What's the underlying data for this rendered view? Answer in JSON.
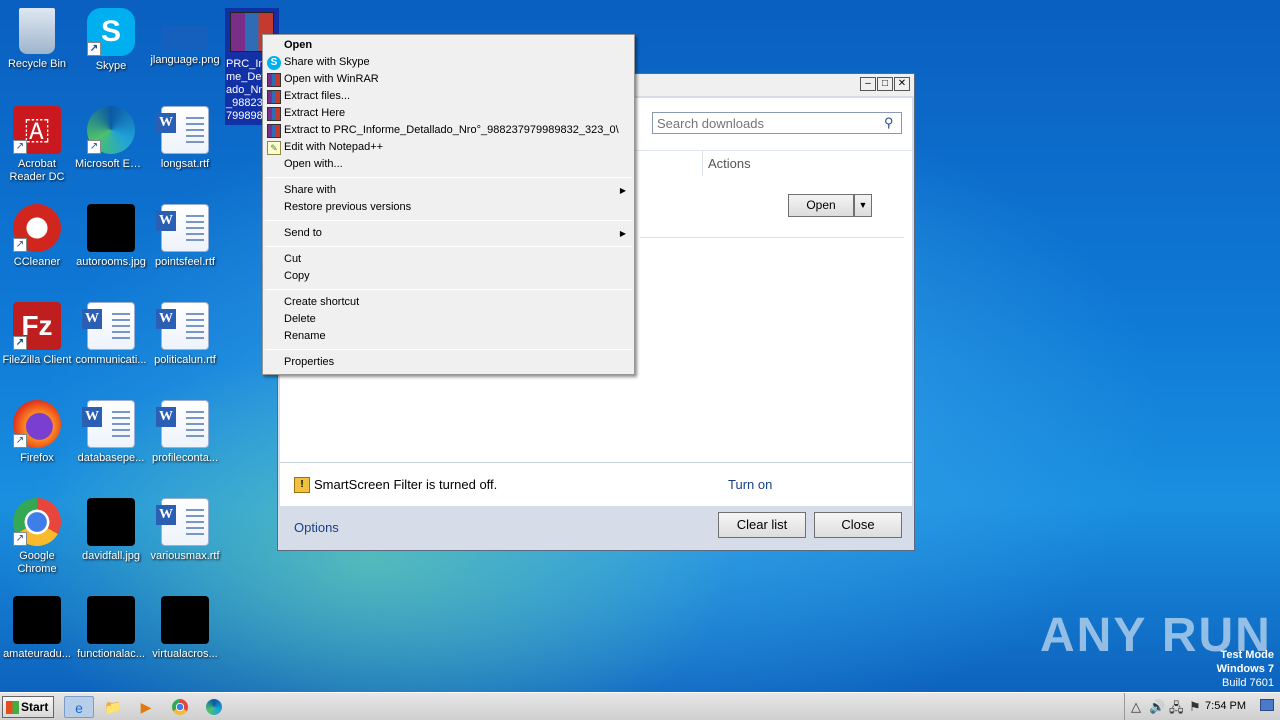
{
  "desktop": {
    "icons": [
      {
        "label": "Recycle Bin"
      },
      {
        "label": "Skype"
      },
      {
        "label": "jlanguage.png"
      },
      {
        "label": "Acrobat Reader DC"
      },
      {
        "label": "Microsoft Edge"
      },
      {
        "label": "longsat.rtf"
      },
      {
        "label": "CCleaner"
      },
      {
        "label": "autorooms.jpg"
      },
      {
        "label": "pointsfeel.rtf"
      },
      {
        "label": "FileZilla Client"
      },
      {
        "label": "communicati..."
      },
      {
        "label": "politicalun.rtf"
      },
      {
        "label": "Firefox"
      },
      {
        "label": "databasepe..."
      },
      {
        "label": "profileconta..."
      },
      {
        "label": "Google Chrome"
      },
      {
        "label": "davidfall.jpg"
      },
      {
        "label": "variousmax.rtf"
      },
      {
        "label": "amateuradu..."
      },
      {
        "label": "functionalac..."
      },
      {
        "label": "virtualacros..."
      }
    ],
    "selected_file_label": "PRC_Informe_Detallado_Nro°_988237979989832_uu"
  },
  "downloads_window": {
    "search_placeholder": "Search downloads",
    "actions_header": "Actions",
    "open_button": "Open",
    "smartscreen_text": "SmartScreen Filter is turned off.",
    "turn_on_link": "Turn on",
    "options_link": "Options",
    "clear_list_button": "Clear list",
    "close_button": "Close"
  },
  "context_menu": {
    "open": "Open",
    "share_skype": "Share with Skype",
    "open_winrar": "Open with WinRAR",
    "extract_files": "Extract files...",
    "extract_here": "Extract Here",
    "extract_to": "Extract to PRC_Informe_Detallado_Nro°_988237979989832_323_0\\",
    "edit_notepad": "Edit with Notepad++",
    "open_with": "Open with...",
    "share_with": "Share with",
    "restore": "Restore previous versions",
    "send_to": "Send to",
    "cut": "Cut",
    "copy": "Copy",
    "create_shortcut": "Create shortcut",
    "delete": "Delete",
    "rename": "Rename",
    "properties": "Properties"
  },
  "watermark": {
    "brand": "ANY RUN",
    "line1": "Test Mode",
    "line2": "Windows 7",
    "line3": "Build 7601"
  },
  "taskbar": {
    "start_label": "Start",
    "clock": "7:54 PM"
  }
}
